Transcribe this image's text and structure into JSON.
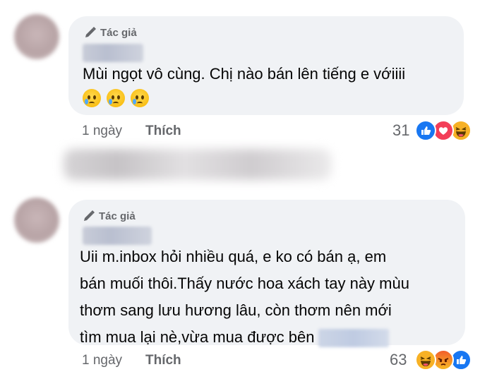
{
  "comments": [
    {
      "author_badge": "Tác giả",
      "text": "Mùi ngọt vô cùng. Chị nào bán lên tiếng e vớiiii",
      "emojis": [
        "crying-face",
        "crying-face",
        "crying-face"
      ],
      "time": "1 ngày",
      "like_label": "Thích",
      "reaction_count": "31",
      "reactions": [
        "like",
        "love",
        "haha"
      ]
    },
    {
      "author_badge": "Tác giả",
      "text_lines": [
        "Uii m.inbox hỏi nhiều quá, e ko có bán ạ, em",
        "bán muối thôi.Thấy nước hoa xách tay này mùu",
        "thơm sang lưu hương lâu, còn thơm nên mới",
        "tìm mua lại nè,vừa mua được bên"
      ],
      "time": "1 ngày",
      "like_label": "Thích",
      "reaction_count": "63",
      "reactions": [
        "haha",
        "angry",
        "like"
      ]
    }
  ],
  "colors": {
    "bubble": "#f0f2f5",
    "secondary_text": "#65676b",
    "like": "#1877f2",
    "love": "#f33e58",
    "haha": "#f7b125"
  }
}
